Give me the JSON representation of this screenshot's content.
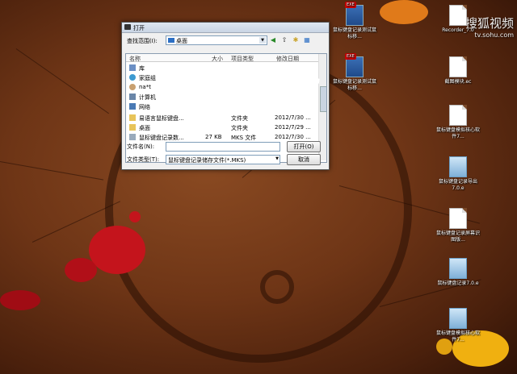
{
  "desktop_icons": [
    {
      "label": "鼠标键盘记录测试鼠标移...",
      "type": "video"
    },
    {
      "label": "鼠标键盘记录测试鼠标移...",
      "type": "video"
    },
    {
      "label": "Recorder_7.0",
      "type": "doc"
    },
    {
      "label": "截图模块.ec",
      "type": "doc"
    },
    {
      "label": "鼠标键盘模拟核心软件7...",
      "type": "doc"
    },
    {
      "label": "鼠标键盘记录导出7.0.e",
      "type": "setup"
    },
    {
      "label": "鼠标键盘记录屏幕识图版...",
      "type": "doc"
    },
    {
      "label": "鼠标键盘记录7.0.e",
      "type": "setup"
    },
    {
      "label": "鼠标键盘模拟核心软件7...",
      "type": "setup"
    }
  ],
  "watermark": {
    "name": "搜狐视频",
    "url": "tv.sohu.com"
  },
  "dialog": {
    "title": "打开",
    "look_in_label": "查找范围(I):",
    "look_in_value": "桌面",
    "columns": {
      "name": "名称",
      "size": "大小",
      "type": "项目类型",
      "modified": "修改日期"
    },
    "items": [
      {
        "name": "库",
        "size": "",
        "type": "",
        "modified": "",
        "icon": "library-icon"
      },
      {
        "name": "家庭组",
        "size": "",
        "type": "",
        "modified": "",
        "icon": "homegroup-icon"
      },
      {
        "name": "na*t",
        "size": "",
        "type": "",
        "modified": "",
        "icon": "user-icon"
      },
      {
        "name": "计算机",
        "size": "",
        "type": "",
        "modified": "",
        "icon": "computer-icon"
      },
      {
        "name": "网络",
        "size": "",
        "type": "",
        "modified": "",
        "icon": "network-icon"
      },
      {
        "name": "易语言鼠标键盘...",
        "size": "",
        "type": "文件夹",
        "modified": "2012/7/30 ...",
        "icon": "folder-icon"
      },
      {
        "name": "桌面",
        "size": "",
        "type": "文件夹",
        "modified": "2012/7/29 ...",
        "icon": "folder-icon"
      },
      {
        "name": "鼠标键盘记录数...",
        "size": "27 KB",
        "type": "MKS 文件",
        "modified": "2012/7/30 ...",
        "icon": "file-icon"
      }
    ],
    "filename_label": "文件名(N):",
    "filename_value": "",
    "filetype_label": "文件类型(T):",
    "filetype_value": "鼠标键盘记录储存文件(*.MKS)",
    "open_button": "打开(O)",
    "cancel_button": "取消"
  }
}
